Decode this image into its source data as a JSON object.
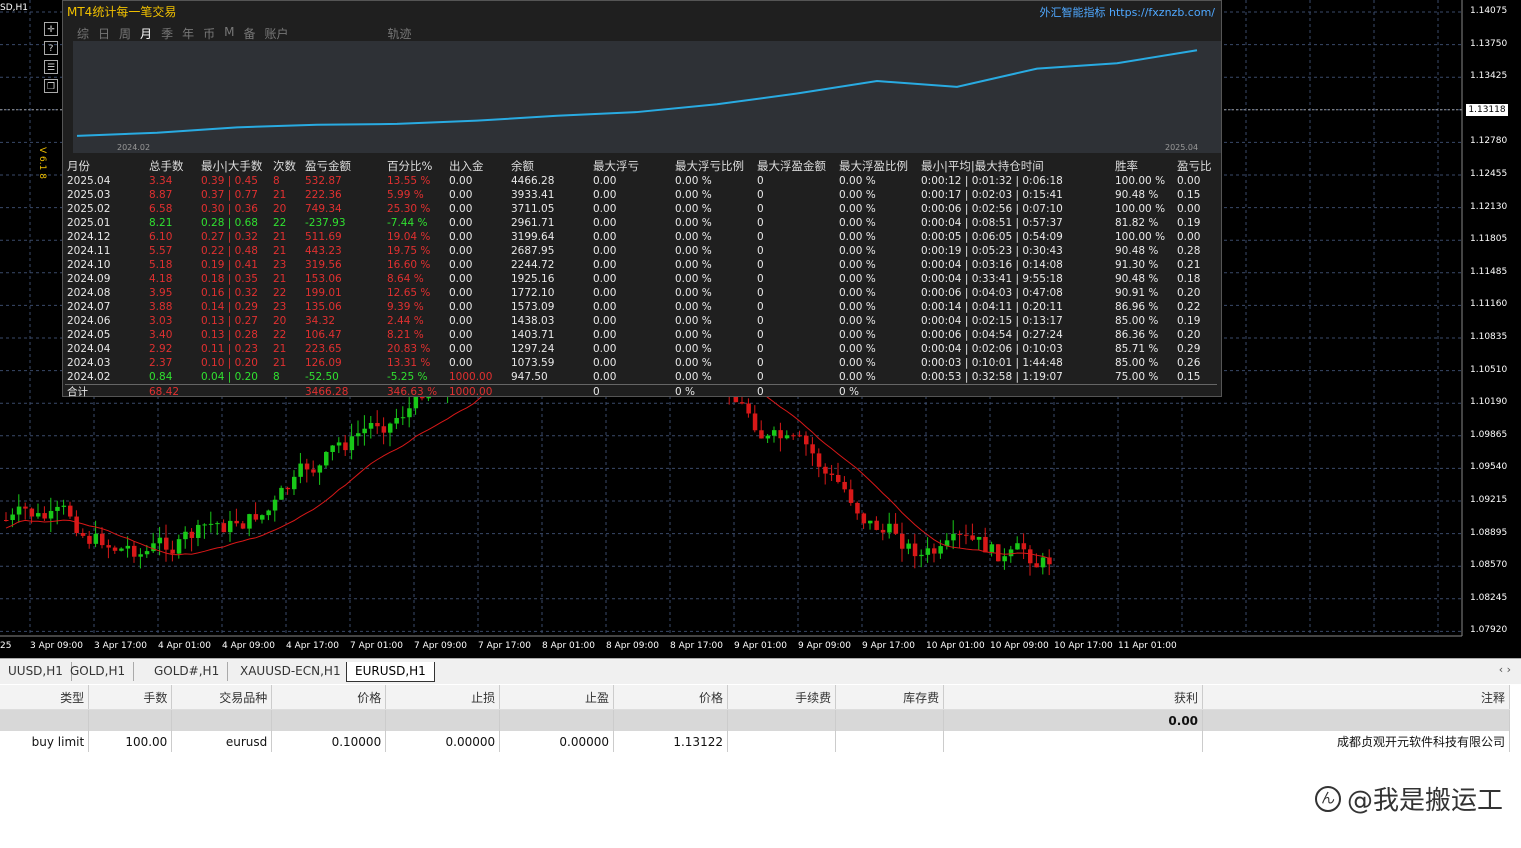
{
  "chart": {
    "corner_symbol": "SD,H1",
    "price_levels": [
      "1.14075",
      "1.13750",
      "1.13425",
      "1.13118",
      "1.12780",
      "1.12455",
      "1.12130",
      "1.11805",
      "1.11485",
      "1.11160",
      "1.10835",
      "1.10510",
      "1.10190",
      "1.09865",
      "1.09540",
      "1.09215",
      "1.08895",
      "1.08570",
      "1.08245",
      "1.07920"
    ],
    "current_price": "1.13118",
    "time_labels": [
      "25",
      "3 Apr 09:00",
      "3 Apr 17:00",
      "4 Apr 01:00",
      "4 Apr 09:00",
      "4 Apr 17:00",
      "7 Apr 01:00",
      "7 Apr 09:00",
      "7 Apr 17:00",
      "8 Apr 01:00",
      "8 Apr 09:00",
      "8 Apr 17:00",
      "9 Apr 01:00",
      "9 Apr 09:00",
      "9 Apr 17:00",
      "10 Apr 01:00",
      "10 Apr 09:00",
      "10 Apr 17:00",
      "11 Apr 01:00"
    ],
    "vertical_label": "V 6.1 8",
    "colors": {
      "bull": "#18c818",
      "bear": "#d81818",
      "ma": "#d81818",
      "grid": "#3a4a6a",
      "line": "#29abe2"
    }
  },
  "panel": {
    "title": "MT4统计每一笔交易",
    "brand": "外汇智能指标",
    "brand_url": "https://fxznzb.com/",
    "tabs": [
      "综",
      "日",
      "周",
      "月",
      "季",
      "年",
      "币",
      "M",
      "备",
      "账户"
    ],
    "active_tab": "月",
    "track_tab": "轨迹",
    "mini_start": "2024.02",
    "mini_end": "2025.04",
    "headers": [
      "月份",
      "总手数",
      "最小|大手数",
      "次数",
      "盈亏金额",
      "百分比%",
      "出入金",
      "余额",
      "最大浮亏",
      "最大浮亏比例",
      "最大浮盈金额",
      "最大浮盈比例",
      "最小|平均|最大持仓时间",
      "",
      "胜率",
      "盈亏比"
    ],
    "rows": [
      {
        "month": "2025.04",
        "lots": "3.34",
        "minmax": "0.39 | 0.45",
        "count": "8",
        "pnl": "532.87",
        "pct": "13.55 %",
        "dep": "0.00",
        "bal": "4466.28",
        "mdd": "0.00",
        "mddp": "0.00 %",
        "mfu": "0",
        "mfup": "0.00 %",
        "hold": "0:00:12 | 0:01:32 | 0:06:18",
        "win": "100.00 %",
        "pr": "0.00",
        "c": "r"
      },
      {
        "month": "2025.03",
        "lots": "8.87",
        "minmax": "0.37 | 0.77",
        "count": "21",
        "pnl": "222.36",
        "pct": "5.99 %",
        "dep": "0.00",
        "bal": "3933.41",
        "mdd": "0.00",
        "mddp": "0.00 %",
        "mfu": "0",
        "mfup": "0.00 %",
        "hold": "0:00:17 | 0:02:03 | 0:15:41",
        "win": "90.48 %",
        "pr": "0.15",
        "c": "r"
      },
      {
        "month": "2025.02",
        "lots": "6.58",
        "minmax": "0.30 | 0.36",
        "count": "20",
        "pnl": "749.34",
        "pct": "25.30 %",
        "dep": "0.00",
        "bal": "3711.05",
        "mdd": "0.00",
        "mddp": "0.00 %",
        "mfu": "0",
        "mfup": "0.00 %",
        "hold": "0:00:06 | 0:02:56 | 0:07:10",
        "win": "100.00 %",
        "pr": "0.00",
        "c": "r"
      },
      {
        "month": "2025.01",
        "lots": "8.21",
        "minmax": "0.28 | 0.68",
        "count": "22",
        "pnl": "-237.93",
        "pct": "-7.44 %",
        "dep": "0.00",
        "bal": "2961.71",
        "mdd": "0.00",
        "mddp": "0.00 %",
        "mfu": "0",
        "mfup": "0.00 %",
        "hold": "0:00:04 | 0:08:51 | 0:57:37",
        "win": "81.82 %",
        "pr": "0.19",
        "c": "g"
      },
      {
        "month": "2024.12",
        "lots": "6.10",
        "minmax": "0.27 | 0.32",
        "count": "21",
        "pnl": "511.69",
        "pct": "19.04 %",
        "dep": "0.00",
        "bal": "3199.64",
        "mdd": "0.00",
        "mddp": "0.00 %",
        "mfu": "0",
        "mfup": "0.00 %",
        "hold": "0:00:05 | 0:06:05 | 0:54:09",
        "win": "100.00 %",
        "pr": "0.00",
        "c": "r"
      },
      {
        "month": "2024.11",
        "lots": "5.57",
        "minmax": "0.22 | 0.48",
        "count": "21",
        "pnl": "443.23",
        "pct": "19.75 %",
        "dep": "0.00",
        "bal": "2687.95",
        "mdd": "0.00",
        "mddp": "0.00 %",
        "mfu": "0",
        "mfup": "0.00 %",
        "hold": "0:00:19 | 0:05:23 | 0:30:43",
        "win": "90.48 %",
        "pr": "0.28",
        "c": "r"
      },
      {
        "month": "2024.10",
        "lots": "5.18",
        "minmax": "0.19 | 0.41",
        "count": "23",
        "pnl": "319.56",
        "pct": "16.60 %",
        "dep": "0.00",
        "bal": "2244.72",
        "mdd": "0.00",
        "mddp": "0.00 %",
        "mfu": "0",
        "mfup": "0.00 %",
        "hold": "0:00:04 | 0:03:16 | 0:14:08",
        "win": "91.30 %",
        "pr": "0.21",
        "c": "r"
      },
      {
        "month": "2024.09",
        "lots": "4.18",
        "minmax": "0.18 | 0.35",
        "count": "21",
        "pnl": "153.06",
        "pct": "8.64 %",
        "dep": "0.00",
        "bal": "1925.16",
        "mdd": "0.00",
        "mddp": "0.00 %",
        "mfu": "0",
        "mfup": "0.00 %",
        "hold": "0:00:04 | 0:33:41 | 9:55:18",
        "win": "90.48 %",
        "pr": "0.18",
        "c": "r"
      },
      {
        "month": "2024.08",
        "lots": "3.95",
        "minmax": "0.16 | 0.32",
        "count": "22",
        "pnl": "199.01",
        "pct": "12.65 %",
        "dep": "0.00",
        "bal": "1772.10",
        "mdd": "0.00",
        "mddp": "0.00 %",
        "mfu": "0",
        "mfup": "0.00 %",
        "hold": "0:00:06 | 0:04:03 | 0:47:08",
        "win": "90.91 %",
        "pr": "0.20",
        "c": "r"
      },
      {
        "month": "2024.07",
        "lots": "3.88",
        "minmax": "0.14 | 0.29",
        "count": "23",
        "pnl": "135.06",
        "pct": "9.39 %",
        "dep": "0.00",
        "bal": "1573.09",
        "mdd": "0.00",
        "mddp": "0.00 %",
        "mfu": "0",
        "mfup": "0.00 %",
        "hold": "0:00:14 | 0:04:11 | 0:20:11",
        "win": "86.96 %",
        "pr": "0.22",
        "c": "r"
      },
      {
        "month": "2024.06",
        "lots": "3.03",
        "minmax": "0.13 | 0.27",
        "count": "20",
        "pnl": "34.32",
        "pct": "2.44 %",
        "dep": "0.00",
        "bal": "1438.03",
        "mdd": "0.00",
        "mddp": "0.00 %",
        "mfu": "0",
        "mfup": "0.00 %",
        "hold": "0:00:04 | 0:02:15 | 0:13:17",
        "win": "85.00 %",
        "pr": "0.19",
        "c": "r"
      },
      {
        "month": "2024.05",
        "lots": "3.40",
        "minmax": "0.13 | 0.28",
        "count": "22",
        "pnl": "106.47",
        "pct": "8.21 %",
        "dep": "0.00",
        "bal": "1403.71",
        "mdd": "0.00",
        "mddp": "0.00 %",
        "mfu": "0",
        "mfup": "0.00 %",
        "hold": "0:00:06 | 0:04:54 | 0:27:24",
        "win": "86.36 %",
        "pr": "0.20",
        "c": "r"
      },
      {
        "month": "2024.04",
        "lots": "2.92",
        "minmax": "0.11 | 0.23",
        "count": "21",
        "pnl": "223.65",
        "pct": "20.83 %",
        "dep": "0.00",
        "bal": "1297.24",
        "mdd": "0.00",
        "mddp": "0.00 %",
        "mfu": "0",
        "mfup": "0.00 %",
        "hold": "0:00:04 | 0:02:06 | 0:10:03",
        "win": "85.71 %",
        "pr": "0.29",
        "c": "r"
      },
      {
        "month": "2024.03",
        "lots": "2.37",
        "minmax": "0.10 | 0.20",
        "count": "21",
        "pnl": "126.09",
        "pct": "13.31 %",
        "dep": "0.00",
        "bal": "1073.59",
        "mdd": "0.00",
        "mddp": "0.00 %",
        "mfu": "0",
        "mfup": "0.00 %",
        "hold": "0:00:03 | 0:10:01 | 1:44:48",
        "win": "85.00 %",
        "pr": "0.26",
        "c": "r"
      },
      {
        "month": "2024.02",
        "lots": "0.84",
        "minmax": "0.04 | 0.20",
        "count": "8",
        "pnl": "-52.50",
        "pct": "-5.25 %",
        "dep": "1000.00",
        "bal": "947.50",
        "mdd": "0.00",
        "mddp": "0.00 %",
        "mfu": "0",
        "mfup": "0.00 %",
        "hold": "0:00:53 | 0:32:58 | 1:19:07",
        "win": "75.00 %",
        "pr": "0.15",
        "c": "g"
      }
    ],
    "total": {
      "label": "合计",
      "lots": "68.42",
      "pnl": "3466.28",
      "pct": "346.63 %",
      "dep": "1000.00",
      "mdd": "0",
      "mddp": "0 %",
      "mfu": "0",
      "mfup": "0 %"
    },
    "balance_curve": [
      947.5,
      1073.59,
      1297.24,
      1403.71,
      1438.03,
      1573.09,
      1772.1,
      1925.16,
      2244.72,
      2687.95,
      3199.64,
      2961.71,
      3711.05,
      3933.41,
      4466.28
    ]
  },
  "chart_tabs": [
    "UUSD,H1",
    "GOLD,H1",
    "GOLD#,H1",
    "XAUUSD-ECN,H1",
    "EURUSD,H1"
  ],
  "active_chart_tab": "EURUSD,H1",
  "orders": {
    "headers": [
      "类型",
      "手数",
      "交易品种",
      "价格",
      "止损",
      "止盈",
      "价格",
      "手续费",
      "库存费",
      "获利",
      "注释"
    ],
    "total_profit": "0.00",
    "row": {
      "type": "buy limit",
      "lots": "100.00",
      "symbol": "eurusd",
      "price": "0.10000",
      "sl": "0.00000",
      "tp": "0.00000",
      "cur": "1.13122",
      "fee": "",
      "swap": "",
      "profit": "",
      "comment": "成都贞观开元软件科技有限公司"
    }
  },
  "watermark": "@我是搬运工"
}
